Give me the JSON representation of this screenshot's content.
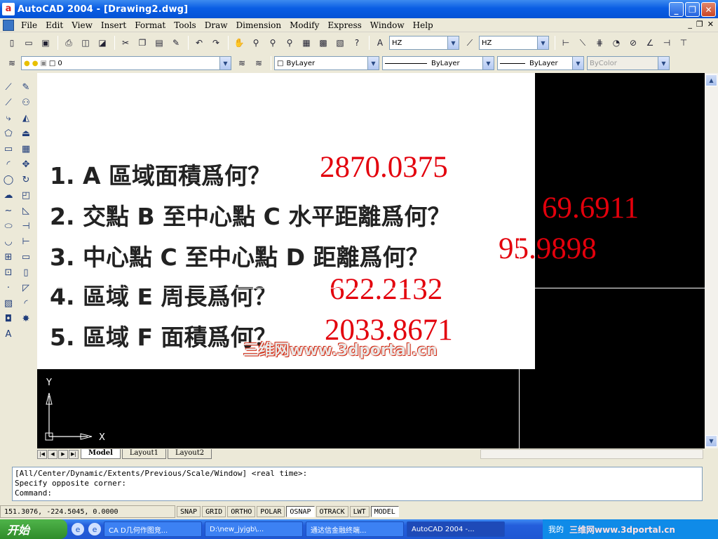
{
  "window": {
    "app_icon": "a",
    "title": "AutoCAD 2004 - [Drawing2.dwg]",
    "buttons": [
      "_",
      "❐",
      "✕"
    ]
  },
  "menu": [
    "File",
    "Edit",
    "View",
    "Insert",
    "Format",
    "Tools",
    "Draw",
    "Dimension",
    "Modify",
    "Express",
    "Window",
    "Help"
  ],
  "mdi_buttons": [
    "_",
    "❐",
    "✕"
  ],
  "toolbar": {
    "text_style": "HZ",
    "dim_style": "HZ",
    "layer": "0",
    "color": "ByLayer",
    "linetype": "ByLayer",
    "lineweight": "ByLayer",
    "plotstyle": "ByColor"
  },
  "drawing": {
    "questions": [
      {
        "q": "1. A 區域面積爲何？",
        "a": "2870.0375"
      },
      {
        "q": "2. 交點 B 至中心點 C 水平距離爲何？",
        "a": "69.6911"
      },
      {
        "q": "3. 中心點 C 至中心點 D 距離爲何？",
        "a": "95.9898"
      },
      {
        "q": "4. 區域 E 周長爲何？",
        "a": "622.2132"
      },
      {
        "q": "5. 區域 F 面積爲何？",
        "a": "2033.8671"
      }
    ],
    "watermark": "三维网www.3dportal.cn",
    "ucs_y": "Y",
    "ucs_x": "X"
  },
  "tabs": [
    "Model",
    "Layout1",
    "Layout2"
  ],
  "command_lines": [
    "[All/Center/Dynamic/Extents/Previous/Scale/Window] <real time>:",
    "Specify opposite corner:",
    "Command:"
  ],
  "status": {
    "coords": "151.3076, -224.5045, 0.0000",
    "buttons": [
      "SNAP",
      "GRID",
      "ORTHO",
      "POLAR",
      "OSNAP",
      "OTRACK",
      "LWT",
      "MODEL"
    ]
  },
  "taskbar": {
    "start": "开始",
    "tasks": [
      "CA D几何作图竞...",
      "D:\\new_jyjgb\\...",
      "通达信金融终端...",
      "AutoCAD 2004 -..."
    ],
    "tray_text": "我的",
    "tray_watermark": "三维网www.3dportal.cn"
  }
}
